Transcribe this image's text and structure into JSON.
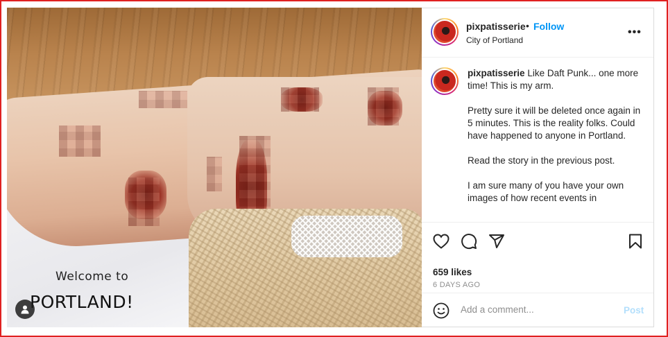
{
  "post": {
    "image_overlay": {
      "line1": "Welcome to",
      "line2": "PORTLAND!"
    },
    "header": {
      "username": "pixpatisserie",
      "separator": "•",
      "follow_label": "Follow",
      "location": "City of Portland",
      "more_label": "•••"
    },
    "caption": {
      "username": "pixpatisserie",
      "paragraphs": [
        "Like Daft Punk... one more time! This is my arm.",
        "Pretty sure it will be deleted once again in 5 minutes. This is the reality folks. Could have happened to anyone in Portland.",
        "Read the story in the previous post.",
        "I am sure many of you have your own images of how recent events in"
      ]
    },
    "actions": {
      "icons": [
        "heart-icon",
        "comment-icon",
        "share-icon",
        "bookmark-icon"
      ],
      "likes_text": "659 likes",
      "date_text": "6 DAYS AGO"
    },
    "comment": {
      "placeholder": "Add a comment...",
      "post_label": "Post"
    }
  },
  "colors": {
    "link_blue": "#0095f6",
    "post_disabled": "#b3dffc",
    "border": "#dbdbdb",
    "frame_red": "#e02020"
  }
}
